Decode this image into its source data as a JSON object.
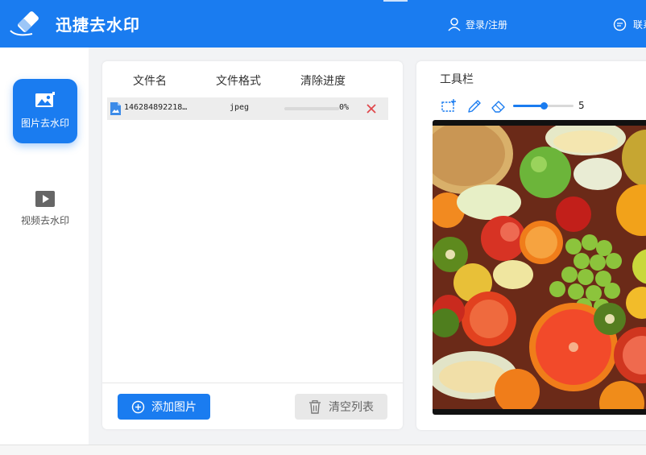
{
  "header": {
    "app_title": "迅捷去水印",
    "login_label": "登录/注册",
    "contact_label": "联系",
    "brand_color": "#1a7cf0"
  },
  "sidebar": {
    "items": [
      {
        "label": "图片去水印",
        "icon": "image-icon",
        "active": true
      },
      {
        "label": "视频去水印",
        "icon": "video-play-icon",
        "active": false
      }
    ]
  },
  "file_list": {
    "columns": [
      "文件名",
      "文件格式",
      "清除进度"
    ],
    "rows": [
      {
        "name": "146284892218…",
        "format": "jpeg",
        "progress": 0,
        "progress_label": "0%"
      }
    ],
    "add_button": "添加图片",
    "clear_button": "清空列表"
  },
  "toolbar": {
    "title": "工具栏",
    "tools": [
      "select-rect-icon",
      "pen-icon",
      "eraser-icon"
    ],
    "brush_size": 5,
    "brush_size_max": 10
  }
}
